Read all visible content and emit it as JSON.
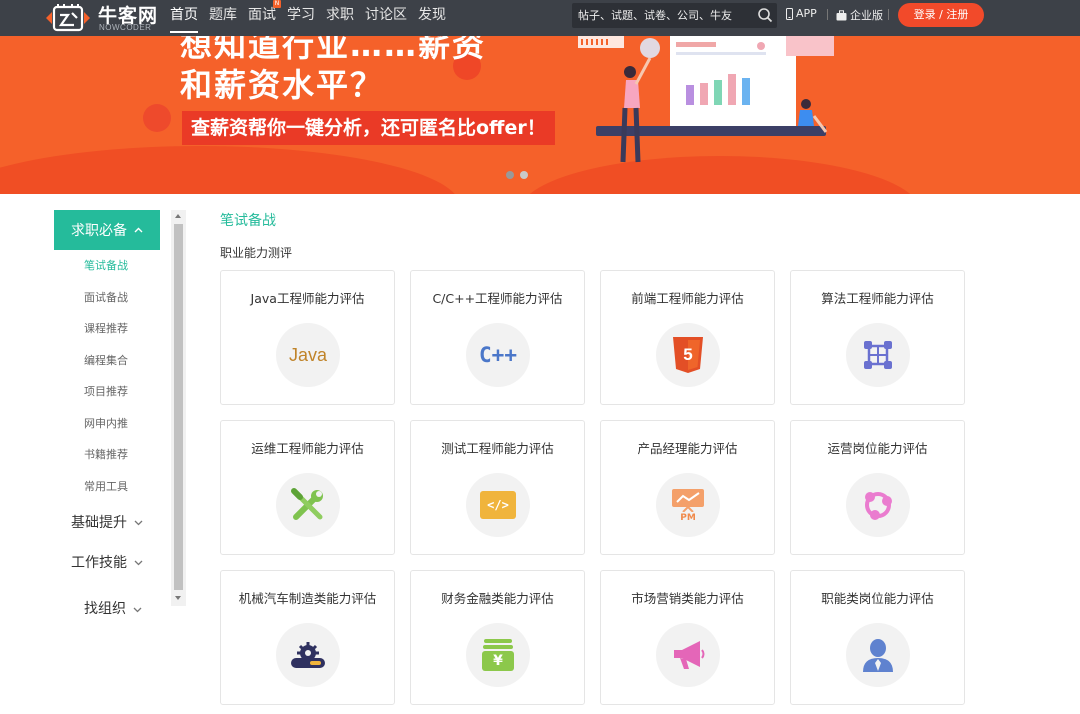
{
  "header": {
    "logo_text": "牛客网",
    "logo_sub": "NOWCODER",
    "nav": [
      {
        "label": "首页",
        "active": true
      },
      {
        "label": "题库"
      },
      {
        "label": "面试",
        "badge": "N"
      },
      {
        "label": "学习"
      },
      {
        "label": "求职"
      },
      {
        "label": "讨论区"
      },
      {
        "label": "发现"
      }
    ],
    "search_placeholder": "帖子、试题、试卷、公司、牛友",
    "app_label": "APP",
    "enterprise_label": "企业版",
    "login_label": "登录 / 注册"
  },
  "banner": {
    "headline_cut": "想知道行业……薪资",
    "headline": "和薪资水平？",
    "subline": "查薪资帮你一键分析，还可匿名比offer！",
    "slide_count": 2,
    "active_slide": 1,
    "colors": {
      "bg": "#f5612a",
      "sub_bg": "#ea3a26"
    }
  },
  "sidebar": {
    "categories": [
      {
        "label": "求职必备",
        "expanded": true,
        "items": [
          "笔试备战",
          "面试备战",
          "课程推荐",
          "编程集合",
          "项目推荐",
          "网申内推",
          "书籍推荐",
          "常用工具"
        ],
        "active_item": 0
      },
      {
        "label": "基础提升",
        "expanded": false
      },
      {
        "label": "工作技能",
        "expanded": false
      },
      {
        "label": "找组织",
        "expanded": false
      }
    ]
  },
  "main": {
    "section_title": "笔试备战",
    "group_title": "职业能力测评",
    "cards": [
      {
        "title": "Java工程师能力评估",
        "icon": "java-icon",
        "icon_text": "Java"
      },
      {
        "title": "C/C++工程师能力评估",
        "icon": "cpp-icon",
        "icon_text": "C++"
      },
      {
        "title": "前端工程师能力评估",
        "icon": "html5-icon",
        "icon_text": "5"
      },
      {
        "title": "算法工程师能力评估",
        "icon": "algorithm-icon"
      },
      {
        "title": "运维工程师能力评估",
        "icon": "wrench-screwdriver-icon"
      },
      {
        "title": "测试工程师能力评估",
        "icon": "code-window-icon",
        "icon_text": "</>"
      },
      {
        "title": "产品经理能力评估",
        "icon": "pm-presentation-icon",
        "icon_text": "PM"
      },
      {
        "title": "运营岗位能力评估",
        "icon": "share-cycle-icon"
      },
      {
        "title": "机械汽车制造类能力评估",
        "icon": "gear-machine-icon"
      },
      {
        "title": "财务金融类能力评估",
        "icon": "money-stack-icon",
        "icon_text": "¥"
      },
      {
        "title": "市场营销类能力评估",
        "icon": "megaphone-icon"
      },
      {
        "title": "职能类岗位能力评估",
        "icon": "person-tie-icon"
      }
    ]
  },
  "colors": {
    "accent": "#25bb9b",
    "topbar": "#3d4148",
    "login": "#f24a2a"
  }
}
